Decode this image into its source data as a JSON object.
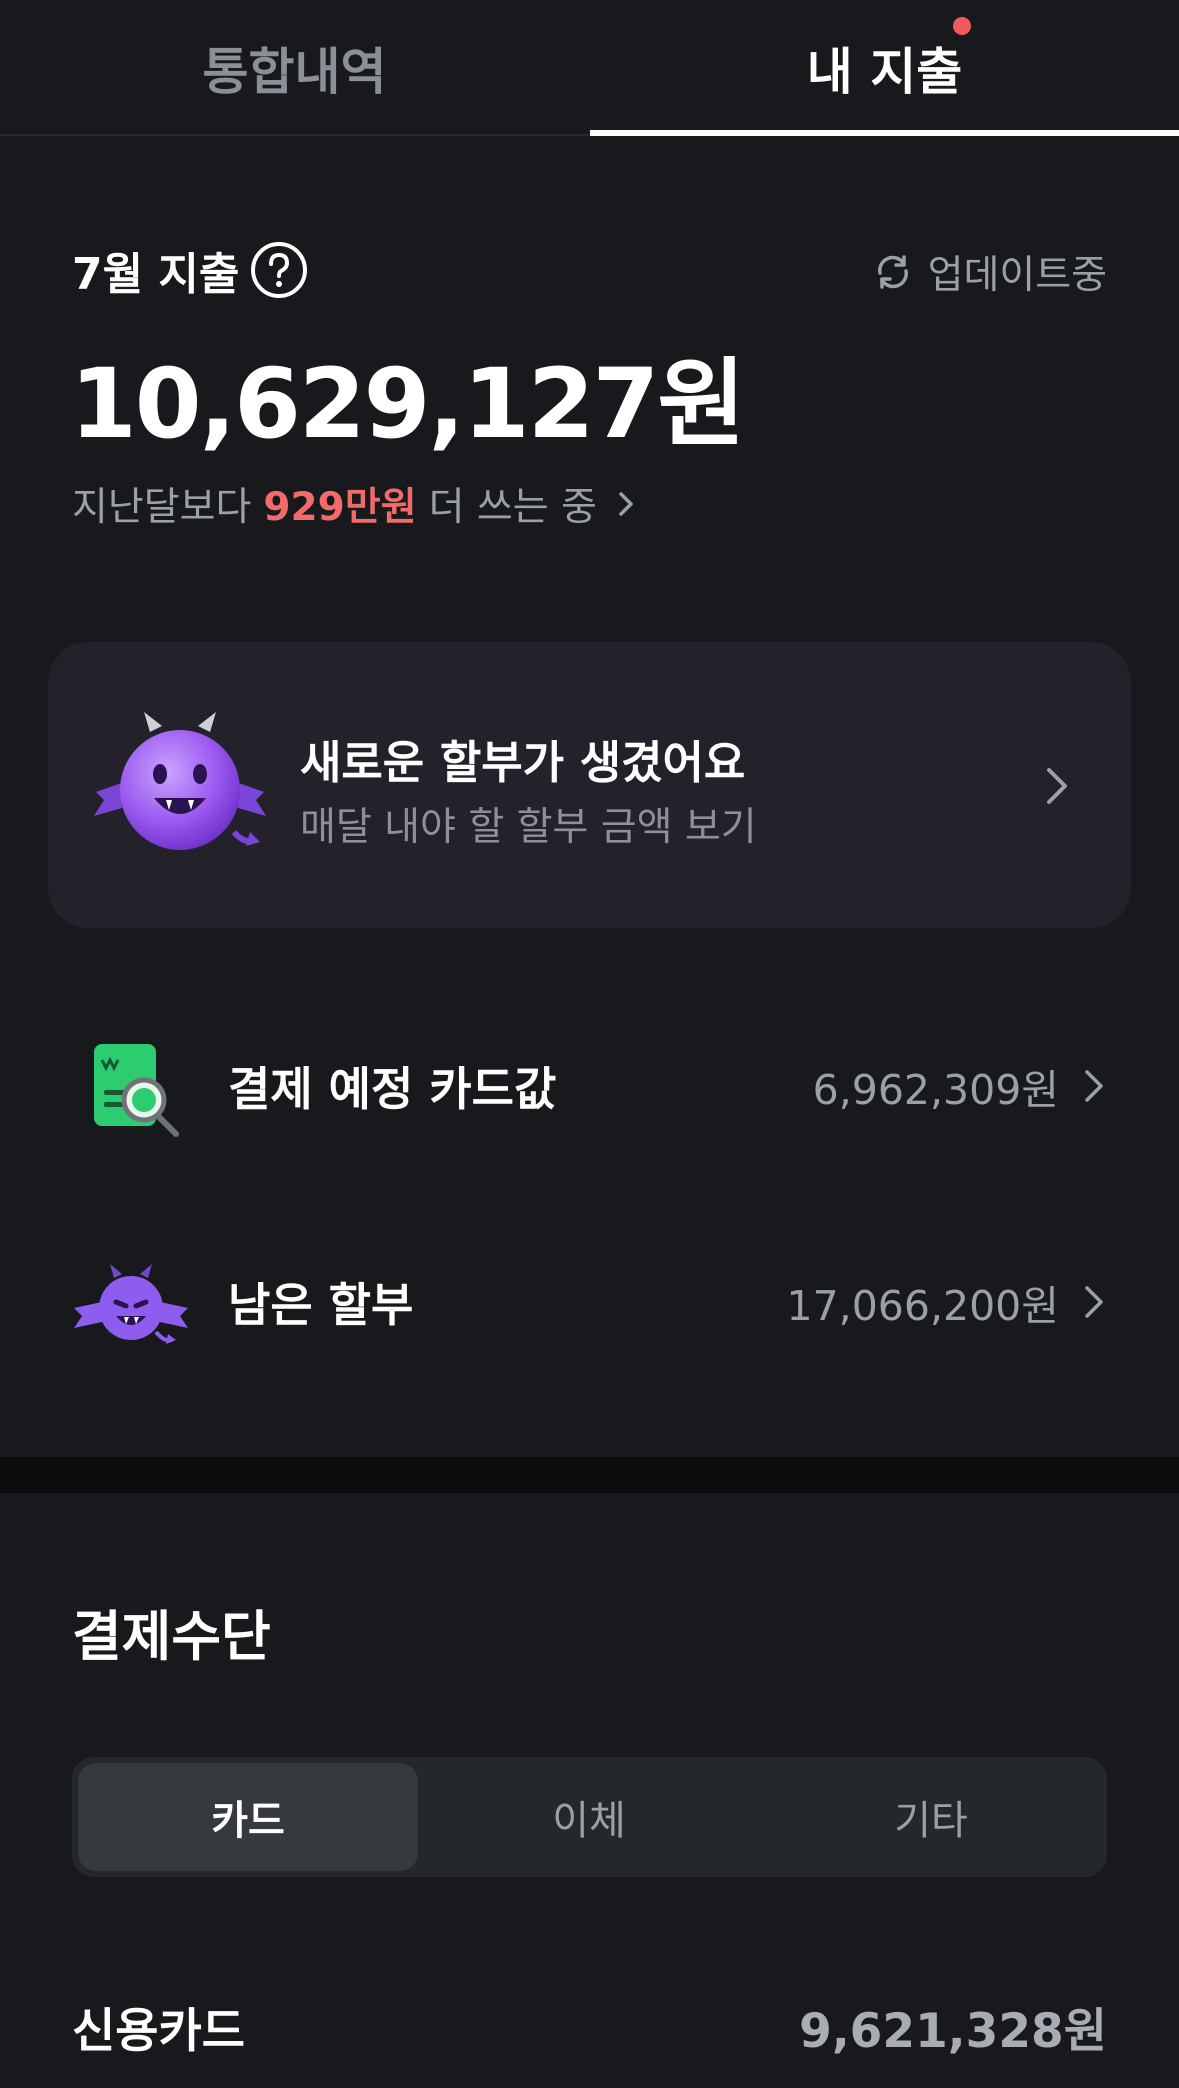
{
  "tabs": {
    "left": "통합내역",
    "right": "내 지출"
  },
  "summary": {
    "month_title": "7월 지출",
    "update_status": "업데이트중",
    "total": "10,629,127원",
    "compare_prefix": "지난달보다",
    "compare_amount": "929만원",
    "compare_suffix": "더 쓰는 중"
  },
  "banner": {
    "title": "새로운 할부가 생겼어요",
    "subtitle": "매달 내야 할 할부 금액 보기"
  },
  "rows": [
    {
      "label": "결제 예정 카드값",
      "value": "6,962,309원",
      "icon": "receipt-search-icon"
    },
    {
      "label": "남은 할부",
      "value": "17,066,200원",
      "icon": "devil-icon"
    }
  ],
  "payment_methods": {
    "title": "결제수단",
    "segments": [
      "카드",
      "이체",
      "기타"
    ],
    "active_segment": "카드",
    "credit_card_label": "신용카드",
    "credit_card_value": "9,621,328원"
  },
  "colors": {
    "background": "#17191c",
    "highlight_red": "#f26a6a",
    "notification_dot": "#f25b5b",
    "banner_bg": "#232129",
    "devil_purple": "#8f5cf0",
    "receipt_green": "#2ecc71"
  }
}
